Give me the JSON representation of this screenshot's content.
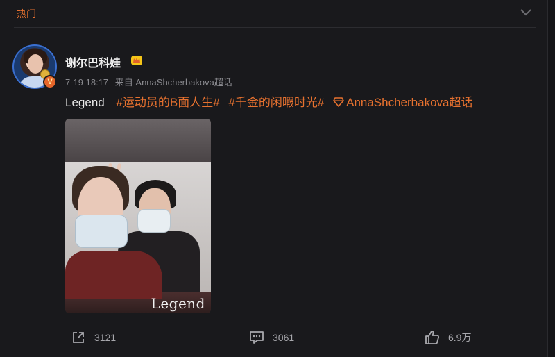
{
  "header": {
    "title": "热门"
  },
  "post": {
    "username": "谢尔巴科娃",
    "time": "7-19 18:17",
    "source": "来自 AnnaShcherbakova超话",
    "text_plain": "Legend",
    "hashtags": [
      "#运动员的B面人生#",
      "#千金的闲暇时光#"
    ],
    "super_topic": "AnnaShcherbakova超话",
    "image_caption": "Legend"
  },
  "actions": {
    "share_count": "3121",
    "comment_count": "3061",
    "like_count": "6.9万"
  },
  "colors": {
    "accent": "#e6712f",
    "background": "#19191c",
    "verified": "#e6662a"
  },
  "icons": {
    "header": "chevron-down-icon",
    "badge": "crown-icon",
    "verified": "verified-v-icon",
    "super_topic": "diamond-icon",
    "share": "share-icon",
    "comment": "comment-icon",
    "like": "thumbs-up-icon"
  }
}
